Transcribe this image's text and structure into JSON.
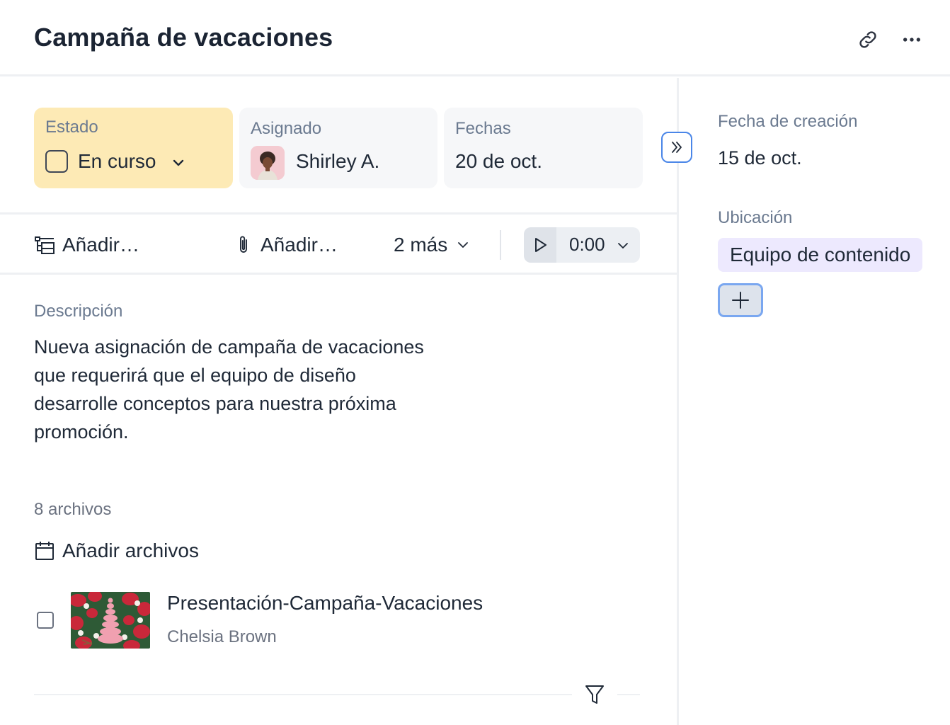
{
  "header": {
    "title": "Campaña de vacaciones",
    "icons": [
      "link-icon",
      "more-horizontal-icon"
    ]
  },
  "status": {
    "label": "Estado",
    "value": "En curso",
    "color": "#fdeab5"
  },
  "assignee": {
    "label": "Asignado",
    "name": "Shirley A."
  },
  "dates": {
    "label": "Fechas",
    "value": "20 de oct."
  },
  "toolbar": {
    "add_subtask": "Añadir…",
    "add_attachment": "Añadir…",
    "more": "2 más",
    "timer": "0:00"
  },
  "description": {
    "label": "Descripción",
    "text": "Nueva asignación de campaña de vacaciones que requerirá que el equipo de diseño desarrolle conceptos para nuestra próxima promoción."
  },
  "files": {
    "count_label": "8 archivos",
    "add_label": "Añadir archivos",
    "items": [
      {
        "name": "Presentación-Campaña-Vacaciones",
        "author": "Chelsia Brown"
      }
    ]
  },
  "sidebar": {
    "created_label": "Fecha de creación",
    "created_value": "15 de oct.",
    "location_label": "Ubicación",
    "location_value": "Equipo de contenido"
  },
  "colors": {
    "accent_blue": "#4a86e8",
    "location_chip": "#ede9fe",
    "status_card": "#fdeab5"
  }
}
